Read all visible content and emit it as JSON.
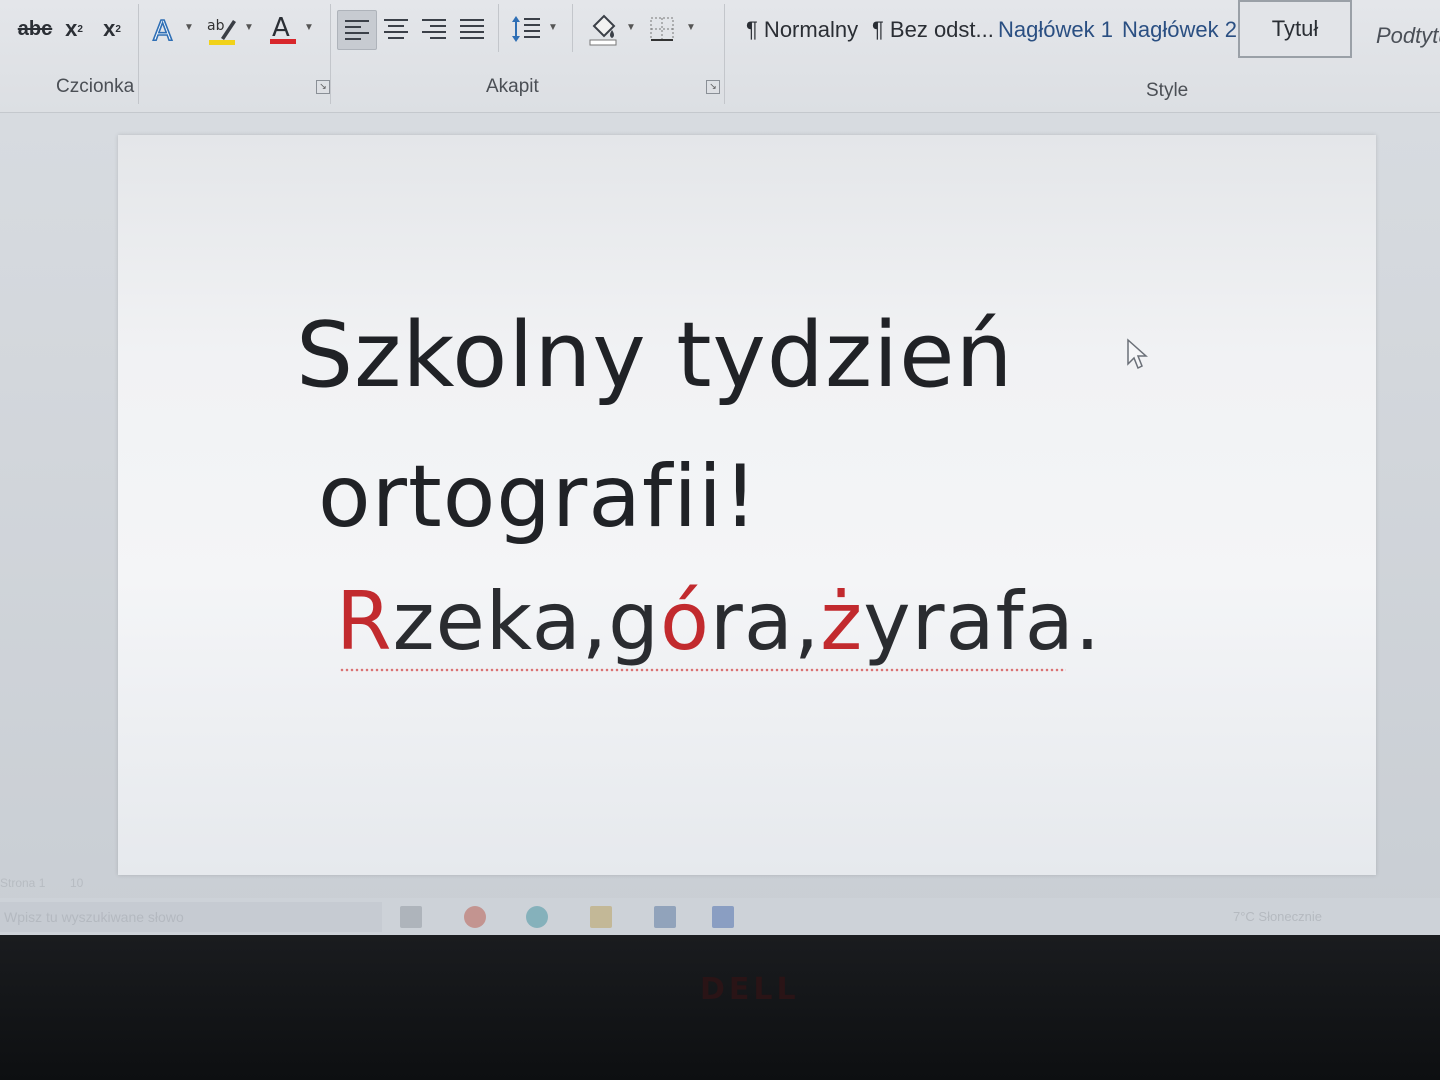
{
  "ribbon": {
    "font_tools": {
      "strikethrough": "abc",
      "subscript": "x",
      "subscript_mark": "2",
      "superscript": "x",
      "superscript_mark": "2"
    },
    "groups": {
      "font": "Czcionka",
      "paragraph": "Akapit",
      "styles": "Style"
    },
    "styles": [
      {
        "label": "¶ Normalny"
      },
      {
        "label": "¶ Bez odst..."
      },
      {
        "label": "Nagłówek 1"
      },
      {
        "label": "Nagłówek 2"
      },
      {
        "label": "Tytuł"
      },
      {
        "label": "Podtytu"
      }
    ],
    "colors": {
      "highlight": "#f1d21a",
      "font_color": "#d8262b",
      "accent": "#2f6fb5"
    }
  },
  "document": {
    "line1": "Szkolny tydzień",
    "line2": "ortografii!",
    "line3_parts": [
      "R",
      "zeka,g",
      "ó",
      "ra,",
      "ż",
      "yrafa."
    ],
    "text_color": "#202226",
    "highlight_color": "#c22a2e"
  },
  "statusbar": {
    "page": "Strona 1",
    "words": "10"
  },
  "taskbar": {
    "search_placeholder": "Wpisz tu wyszukiwane słowo",
    "tray": "7°C  Słonecznie"
  },
  "hardware": {
    "logo": "DELL"
  }
}
